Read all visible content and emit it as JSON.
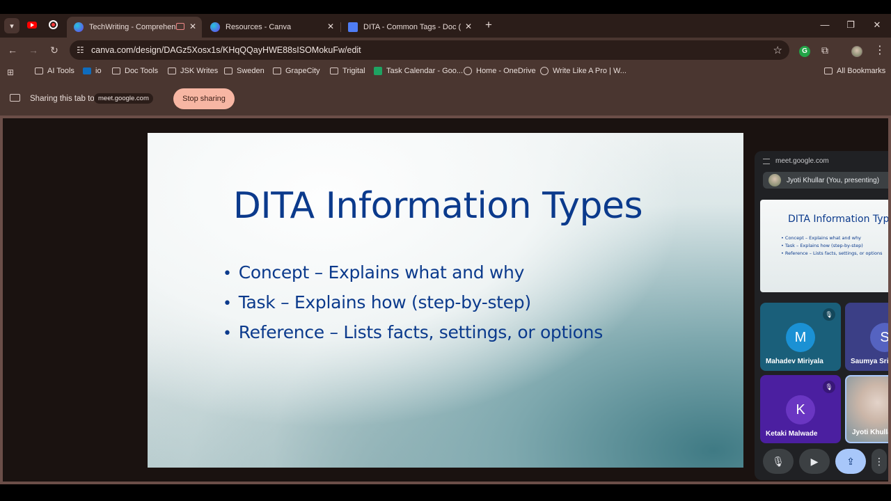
{
  "browser": {
    "tabs": [
      {
        "title": "TechWriting - Comprehensi",
        "active": true
      },
      {
        "title": "Resources - Canva",
        "active": false
      },
      {
        "title": "DITA - Common Tags - Doc (Di",
        "active": false
      }
    ],
    "url": "canva.com/design/DAGz5Xosx1s/KHqQQayHWE88sISOMokuFw/edit",
    "bookmarks": [
      {
        "label": "AI Tools",
        "icon": "folder-icon"
      },
      {
        "label": "io",
        "icon": "outlook-icon"
      },
      {
        "label": "Doc Tools",
        "icon": "folder-icon"
      },
      {
        "label": "JSK Writes",
        "icon": "folder-icon"
      },
      {
        "label": "Sweden",
        "icon": "folder-icon"
      },
      {
        "label": "GrapeCity",
        "icon": "folder-icon"
      },
      {
        "label": "Trigital",
        "icon": "folder-icon"
      },
      {
        "label": "Task Calendar - Goo...",
        "icon": "sheets-icon"
      },
      {
        "label": "Home - OneDrive",
        "icon": "globe-icon"
      },
      {
        "label": "Write Like A Pro | W...",
        "icon": "globe-icon"
      },
      {
        "label": "All Bookmarks",
        "icon": "folder-icon"
      }
    ]
  },
  "sharing": {
    "text": "Sharing this tab to",
    "target": "meet.google.com",
    "stop_label": "Stop sharing",
    "stop_color": "#f7b6a3"
  },
  "slide": {
    "title": "DITA Information Types",
    "bullets": [
      "Concept – Explains what and why",
      "Task – Explains how (step-by-step)",
      "Reference – Lists facts, settings, or options"
    ],
    "title_color": "#0b3a8c"
  },
  "meet": {
    "url": "meet.google.com",
    "presenter": "Jyoti Khullar (You, presenting)",
    "mini_slide": {
      "title": "DITA Information Types",
      "bullets": [
        "Concept – Explains what and why",
        "Task – Explains how (step-by-step)",
        "Reference – Lists facts, settings, or options"
      ]
    },
    "participants": [
      {
        "initial": "M",
        "name": "Mahadev Miriyala",
        "muted": true
      },
      {
        "initial": "S",
        "name": "Saumya Sriv",
        "muted": false
      },
      {
        "initial": "K",
        "name": "Ketaki Malwade",
        "muted": true
      },
      {
        "initial": "",
        "name": "Jyoti Khullar",
        "muted": false
      }
    ]
  }
}
